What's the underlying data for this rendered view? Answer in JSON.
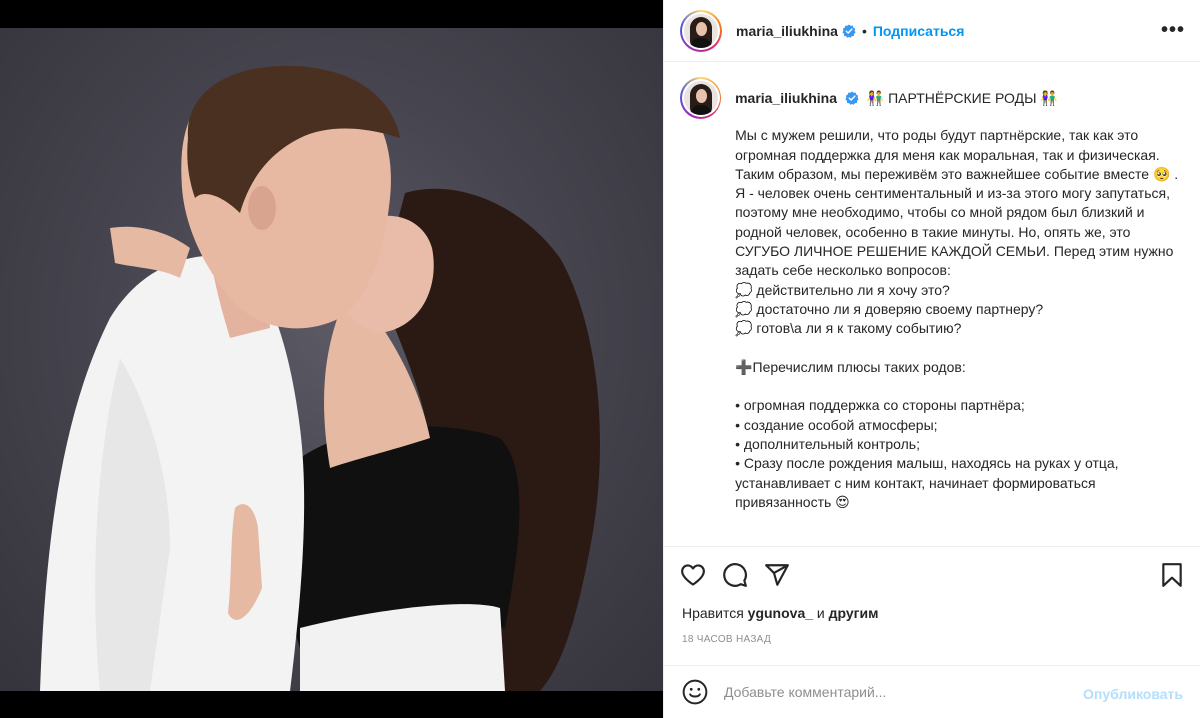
{
  "post": {
    "username": "maria_iliukhina",
    "separator": "•",
    "follow_label": "Подписаться",
    "more_label": "•••",
    "caption_title": "👫 ПАРТНЁРСКИЕ РОДЫ 👫",
    "caption_body": "Мы с мужем решили, что роды будут партнёрские, так как это огромная поддержка для меня как моральная, так и физическая. Таким образом, мы переживём это важнейшее событие вместе 🥺 . Я - человек очень сентиментальный и из-за этого могу запутаться, поэтому мне необходимо, чтобы со мной рядом был близкий и родной человек, особенно в такие минуты. Но, опять же, это СУГУБО ЛИЧНОЕ РЕШЕНИЕ КАЖДОЙ СЕМЬИ. Перед этим нужно задать себе несколько вопросов:\n💭 действительно ли я хочу это?\n💭 достаточно ли я доверяю своему партнеру?\n💭 готов\\а ли я к такому событию?\n\n➕Перечислим плюсы таких родов:\n\n• огромная поддержка со стороны партнёра;\n• создание особой атмосферы;\n• дополнительный контроль;\n• Сразу после рождения малыш, находясь на руках у отца, устанавливает с ним контакт, начинает формироваться привязанность 😍",
    "likes_prefix": "Нравится",
    "likes_user": "ygunova_",
    "likes_and": "и",
    "likes_others": "другим",
    "time_ago": "18 часов назад",
    "comment_placeholder": "Добавьте комментарий...",
    "publish_label": "Опубликовать"
  },
  "icons": {
    "verified": "verified-badge-icon",
    "like": "heart-icon",
    "comment": "comment-icon",
    "share": "paper-plane-icon",
    "save": "bookmark-icon",
    "emoji": "smiley-icon"
  },
  "colors": {
    "link_blue": "#0095f6",
    "publish_disabled": "#b2dffc",
    "muted": "#8e8e8e",
    "text": "#262626"
  }
}
